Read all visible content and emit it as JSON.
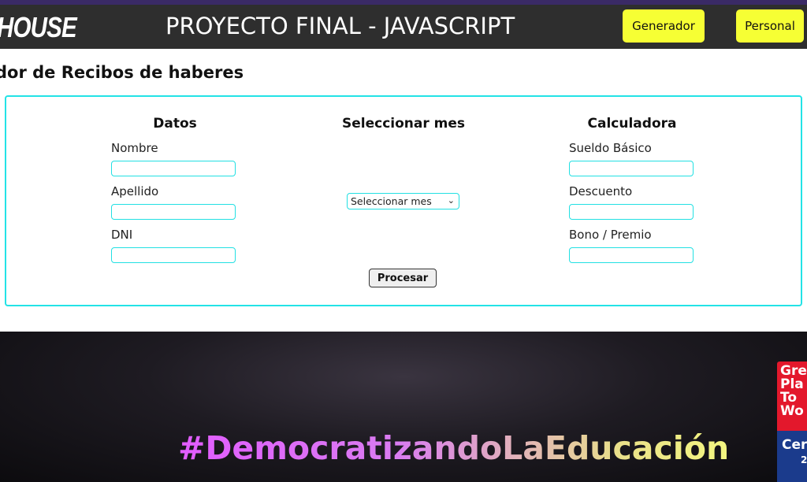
{
  "navbar": {
    "brand": "HOUSE",
    "title": "PROYECTO FINAL - JAVASCRIPT",
    "buttons": {
      "generador": "Generador",
      "personal": "Personal"
    }
  },
  "page": {
    "heading": "dor de Recibos de haberes"
  },
  "form": {
    "datos": {
      "title": "Datos",
      "fields": {
        "nombre": "Nombre",
        "apellido": "Apellido",
        "dni": "DNI"
      }
    },
    "mes": {
      "title": "Seleccionar mes",
      "select_value": "Seleccionar mes"
    },
    "calculadora": {
      "title": "Calculadora",
      "fields": {
        "sueldo": "Sueldo Básico",
        "descuento": "Descuento",
        "bono": "Bono / Premio"
      }
    },
    "submit_label": "Procesar"
  },
  "banner": {
    "hashtag": "#DemocratizandoLaEducación",
    "badge": {
      "top_text": "Gre\nPla\nTo\nWo",
      "cert_text": "Cer",
      "year_text": "2"
    }
  },
  "colors": {
    "nav_bg": "#2e2e2e",
    "button_yellow": "#f6ff34",
    "accent_cyan": "#23e3e6",
    "badge_red": "#e3182c",
    "badge_blue": "#1b3b8c"
  }
}
